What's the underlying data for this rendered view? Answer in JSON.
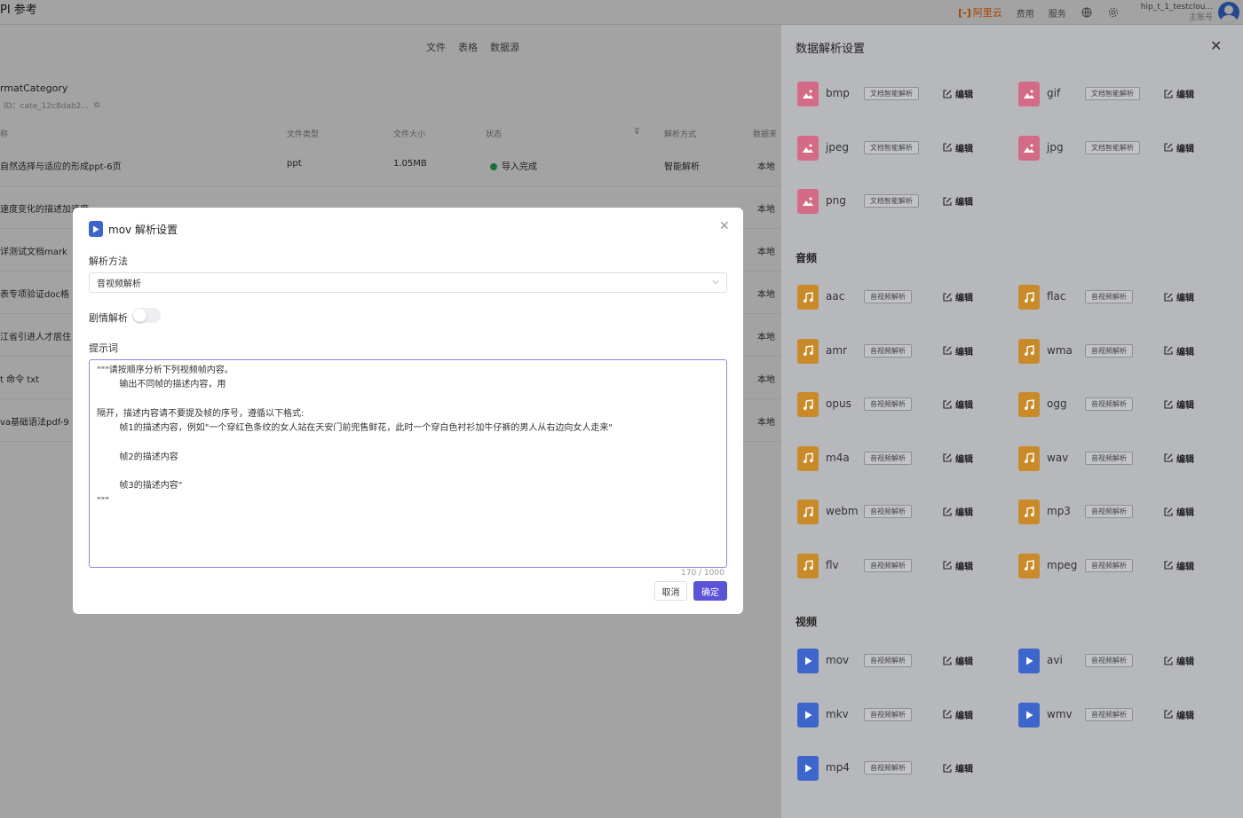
{
  "topbar": {
    "title": "PI 参考",
    "brand": "阿里云",
    "links": [
      "费用",
      "服务"
    ],
    "icons": [
      "globe-icon",
      "gear-icon"
    ],
    "user_name": "hip_t_1_testclou...",
    "user_role": "主账号"
  },
  "page": {
    "tabs": [
      "文件",
      "表格",
      "数据源"
    ],
    "category_name": "rmatCategory",
    "category_id": "ID：cate_12c8dab2...",
    "columns": [
      "称",
      "文件类型",
      "文件大小",
      "状态",
      "解析方式",
      "数据来"
    ],
    "rows": [
      {
        "name": "自然选择与适应的形成ppt-6页",
        "type": "ppt",
        "size": "1.05MB",
        "status": "导入完成",
        "parse": "智能解析",
        "source": "本地"
      },
      {
        "name": "速度变化的描述加速度",
        "type": "",
        "size": "",
        "status": "",
        "parse": "",
        "source": "本地"
      },
      {
        "name": "详测试文档mark",
        "type": "",
        "size": "",
        "status": "",
        "parse": "",
        "source": "本地"
      },
      {
        "name": "表专项验证doc格",
        "type": "",
        "size": "",
        "status": "",
        "parse": "",
        "source": "本地"
      },
      {
        "name": "江省引进人才居住",
        "type": "",
        "size": "",
        "status": "",
        "parse": "",
        "source": "本地"
      },
      {
        "name": "t 命令 txt",
        "type": "",
        "size": "",
        "status": "",
        "parse": "",
        "source": "本地"
      },
      {
        "name": "va基础语法pdf-9",
        "type": "",
        "size": "",
        "status": "",
        "parse": "",
        "source": "本地"
      }
    ]
  },
  "drawer": {
    "title": "数据解析设置",
    "edit_label": "编辑",
    "sections": [
      {
        "title": "",
        "kind": "img",
        "items": [
          {
            "ext": "bmp",
            "tag": "文档智能解析"
          },
          {
            "ext": "gif",
            "tag": "文档智能解析"
          },
          {
            "ext": "jpeg",
            "tag": "文档智能解析"
          },
          {
            "ext": "jpg",
            "tag": "文档智能解析"
          },
          {
            "ext": "png",
            "tag": "文档智能解析"
          }
        ]
      },
      {
        "title": "音频",
        "kind": "aud",
        "items": [
          {
            "ext": "aac",
            "tag": "音视频解析"
          },
          {
            "ext": "flac",
            "tag": "音视频解析"
          },
          {
            "ext": "amr",
            "tag": "音视频解析"
          },
          {
            "ext": "wma",
            "tag": "音视频解析"
          },
          {
            "ext": "opus",
            "tag": "音视频解析"
          },
          {
            "ext": "ogg",
            "tag": "音视频解析"
          },
          {
            "ext": "m4a",
            "tag": "音视频解析"
          },
          {
            "ext": "wav",
            "tag": "音视频解析"
          },
          {
            "ext": "webm",
            "tag": "音视频解析"
          },
          {
            "ext": "mp3",
            "tag": "音视频解析"
          },
          {
            "ext": "flv",
            "tag": "音视频解析"
          },
          {
            "ext": "mpeg",
            "tag": "音视频解析"
          }
        ]
      },
      {
        "title": "视频",
        "kind": "vid",
        "items": [
          {
            "ext": "mov",
            "tag": "音视频解析"
          },
          {
            "ext": "avi",
            "tag": "音视频解析"
          },
          {
            "ext": "mkv",
            "tag": "音视频解析"
          },
          {
            "ext": "wmv",
            "tag": "音视频解析"
          },
          {
            "ext": "mp4",
            "tag": "音视频解析"
          }
        ]
      }
    ]
  },
  "modal": {
    "title": "mov 解析设置",
    "method_label": "解析方法",
    "method_value": "音视频解析",
    "plot_label": "剧情解析",
    "plot_enabled": false,
    "prompt_label": "提示词",
    "prompt_value": "\"\"\"请按顺序分析下列视频帧内容。\n        输出不同帧的描述内容，用\n\n隔开，描述内容请不要提及帧的序号，遵循以下格式:\n        帧1的描述内容，例如\"一个穿红色条纹的女人站在天安门前兜售鲜花，此时一个穿白色衬衫加牛仔裤的男人从右边向女人走来\"\n\n        帧2的描述内容\n\n        帧3的描述内容\"\n\"\"\"",
    "counter": "170 / 1000",
    "cancel_label": "取消",
    "confirm_label": "确定"
  }
}
